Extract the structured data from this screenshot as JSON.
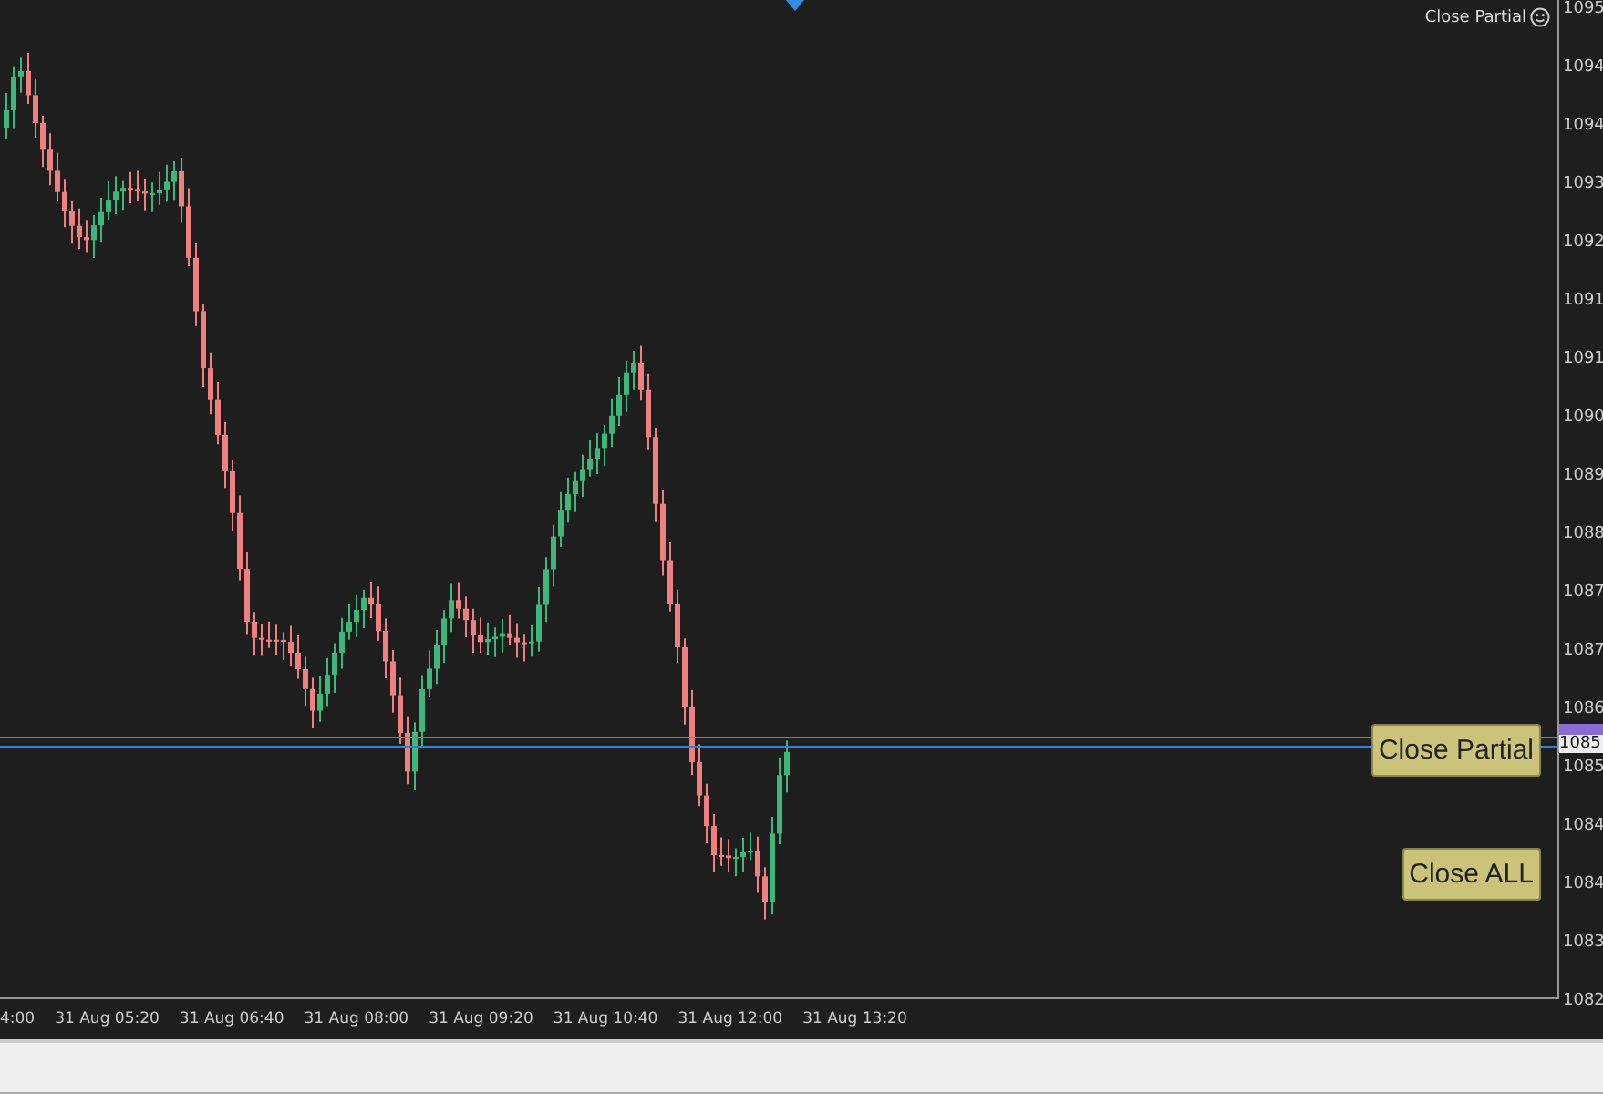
{
  "indicator_label": "Close Partial",
  "buttons": [
    {
      "label": "Close Partial"
    },
    {
      "label": "Close ALL"
    }
  ],
  "price_axis": {
    "ticks": [
      "1095",
      "1094",
      "1094",
      "1093",
      "1092",
      "1091",
      "1091",
      "1090",
      "1089",
      "1088",
      "1087",
      "1087",
      "1086",
      "1085",
      "1084",
      "1084",
      "1083",
      "1082"
    ],
    "current_price": "1085"
  },
  "time_axis": {
    "ticks": [
      "4:00",
      "31 Aug 05:20",
      "31 Aug 06:40",
      "31 Aug 08:00",
      "31 Aug 09:20",
      "31 Aug 10:40",
      "31 Aug 12:00",
      "31 Aug 13:20"
    ]
  }
}
